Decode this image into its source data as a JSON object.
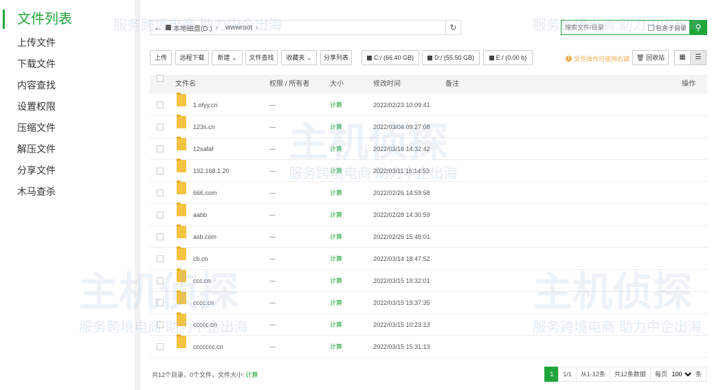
{
  "sidebar": {
    "title": "文件列表",
    "items": [
      "上传文件",
      "下载文件",
      "内容查找",
      "设置权限",
      "压缩文件",
      "解压文件",
      "分享文件",
      "木马查杀"
    ]
  },
  "path": {
    "disk": "本地磁盘(D:)",
    "folder": "wwwroot"
  },
  "search": {
    "placeholder": "搜索文件/目录",
    "subdir_label": "包含子目录"
  },
  "toolbar": {
    "upload": "上传",
    "remote_download": "远程下载",
    "new": "新建",
    "find": "文件查找",
    "favorites": "收藏夹",
    "share_list": "分享列表",
    "disk_c": "C:/ (66.40 GB)",
    "disk_d": "D:/ (55.50 GB)",
    "disk_e": "E:/ (0.00 b)",
    "hint": "文件操作可使用右键",
    "recycle": "回收站"
  },
  "table": {
    "headers": {
      "name": "文件名",
      "perm": "权限 / 所有者",
      "size": "大小",
      "mtime": "修改时间",
      "note": "备注",
      "ops": "操作"
    },
    "rows": [
      {
        "name": "1.ofyy.cn",
        "perm": "---",
        "size": "计算",
        "mtime": "2022/02/23 10:09:41"
      },
      {
        "name": "123s.cn",
        "perm": "---",
        "size": "计算",
        "mtime": "2022/03/04 09:27:08"
      },
      {
        "name": "12safaf",
        "perm": "---",
        "size": "计算",
        "mtime": "2022/03/16 14:32:42"
      },
      {
        "name": "192.168.1.20",
        "perm": "---",
        "size": "计算",
        "mtime": "2022/03/11 16:14:53"
      },
      {
        "name": "666.com",
        "perm": "---",
        "size": "计算",
        "mtime": "2022/02/26 14:59:58"
      },
      {
        "name": "aabb",
        "perm": "---",
        "size": "计算",
        "mtime": "2022/02/28 14:30:59"
      },
      {
        "name": "asb.com",
        "perm": "---",
        "size": "计算",
        "mtime": "2022/02/26 15:48:01"
      },
      {
        "name": "cb.cn",
        "perm": "---",
        "size": "计算",
        "mtime": "2022/03/14 18:47:52"
      },
      {
        "name": "ccc.cn",
        "perm": "---",
        "size": "计算",
        "mtime": "2022/03/15 19:32:01"
      },
      {
        "name": "cccc.cn",
        "perm": "---",
        "size": "计算",
        "mtime": "2022/03/15 19:37:35"
      },
      {
        "name": "ccccc.cn",
        "perm": "---",
        "size": "计算",
        "mtime": "2022/03/15 10:23:13"
      },
      {
        "name": "ccccccc.cn",
        "perm": "---",
        "size": "计算",
        "mtime": "2022/03/15 15:31:13"
      }
    ]
  },
  "footer": {
    "summary": "共12个目录，0个文件，文件大小:",
    "calc": "计算"
  },
  "pager": {
    "current": "1",
    "pages": "1/1",
    "range": "从1-12条",
    "total": "共12条数据",
    "per_page_label": "每页",
    "per_page_value": "100",
    "unit": "条"
  },
  "watermark": {
    "brand": "主机侦探",
    "slogan": "服务跨境电商 助力中企出海"
  },
  "colors": {
    "accent": "#20a53a",
    "warning": "#f0ad4e",
    "folder": "#f5c342"
  }
}
